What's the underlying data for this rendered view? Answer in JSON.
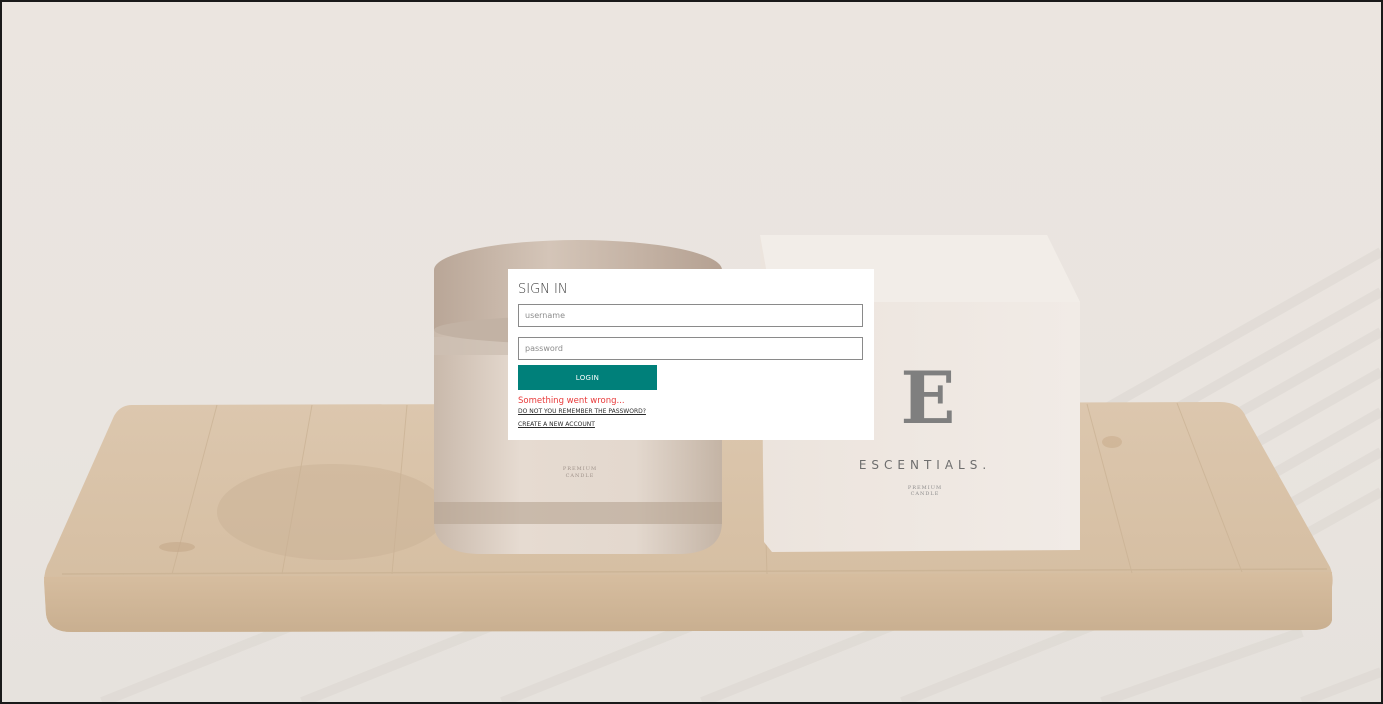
{
  "signin": {
    "title": "SIGN IN",
    "username_placeholder": "username",
    "password_placeholder": "password",
    "login_label": "LOGIN",
    "error": "Something went wrong...",
    "forgot_link": "DO NOT YOU REMEMBER THE PASSWORD?",
    "create_link": "CREATE A NEW ACCOUNT"
  },
  "product": {
    "box_monogram": "E",
    "box_brand": "ESCENTIALS.",
    "box_caption": "PREMIUM CANDLE",
    "jar_caption": "PREMIUM CANDLE"
  },
  "colors": {
    "accent": "#00807a",
    "error": "#e83a3a",
    "background": "#ebe6e1"
  }
}
